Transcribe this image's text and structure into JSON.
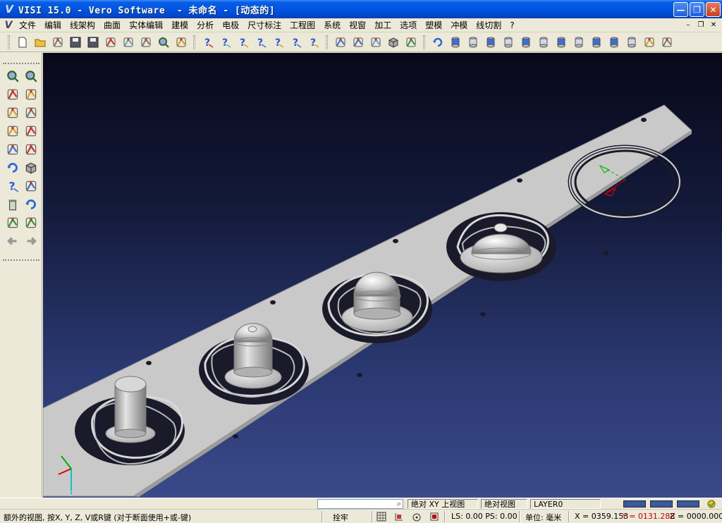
{
  "window": {
    "logo_glyph": "V",
    "title": "VISI 15.0 - Vero Software  - 未命名 - [动态的]",
    "minimize_glyph": "—",
    "maximize_glyph": "❐",
    "close_glyph": "✕"
  },
  "menu": {
    "items": [
      "文件",
      "编辑",
      "线架构",
      "曲面",
      "实体编辑",
      "建模",
      "分析",
      "电极",
      "尺寸标注",
      "工程图",
      "系统",
      "视窗",
      "加工",
      "选项",
      "塑模",
      "冲模",
      "线切割",
      "?"
    ],
    "mdi_min": "–",
    "mdi_restore": "❐",
    "mdi_close": "✕"
  },
  "toolbar": {
    "icons": [
      "new-file-icon",
      "open-folder-icon",
      "open-part-icon",
      "save-icon",
      "save-as-icon",
      "print-icon",
      "import-icon",
      "export-icon",
      "zoom-icon",
      "view-layout-icon",
      "help-icon",
      "query-point-icon",
      "query-entity-icon",
      "query-distance-icon",
      "query-angle-icon",
      "query-curve-icon",
      "query-normal-icon",
      "tree-icon",
      "transform-icon",
      "mold-tool-icon",
      "box-shaded-icon",
      "pin-icon",
      "rotate-view-icon",
      "cylinder-1-icon",
      "cylinder-2-icon",
      "cylinder-3-icon",
      "cylinder-4-icon",
      "cylinder-5-icon",
      "cylinder-6-icon",
      "cylinder-7-icon",
      "cylinder-8-icon",
      "cylinder-9-icon",
      "cylinder-10-icon",
      "cylinder-11-icon",
      "grid-icon",
      "snap-icon"
    ]
  },
  "palette": {
    "icons": [
      "zoom-window-icon",
      "zoom-pencil-icon",
      "frame-icon",
      "sketch-icon",
      "wire-edit-icon",
      "note-icon",
      "curve-tool-icon",
      "pen-icon",
      "layers-icon",
      "surface-icon",
      "refresh-icon",
      "solid-cube-icon",
      "query-icon",
      "dimension-icon",
      "trash-icon",
      "undo-view-icon",
      "properties-icon",
      "screen-capture-icon",
      "arrow-left-icon",
      "arrow-right-icon"
    ]
  },
  "viewport": {
    "triad_x": "X",
    "triad_y": "Y",
    "triad_z": "Z"
  },
  "status": {
    "view_top": "绝对 XY 上视图",
    "view_abs": "绝对视图",
    "layer": "LAYER0",
    "hint": "额外的视图, 按X, Y, Z, V或R键 (对于断面使用+或-键)",
    "snap": "拴牢",
    "ls_ps": "LS: 0.00 PS: 0.00",
    "unit": "单位: 毫米",
    "x_coord": "X = 0359.153",
    "y_coord": "Y = 0131.288",
    "z_coord": "Z = 0000.000"
  },
  "colors": {
    "titlebar": "#0054e3",
    "viewport_top": "#08081a",
    "viewport_bottom": "#3a4a8a",
    "plate": "#c8c8c8",
    "y_coord": "#d00000"
  }
}
